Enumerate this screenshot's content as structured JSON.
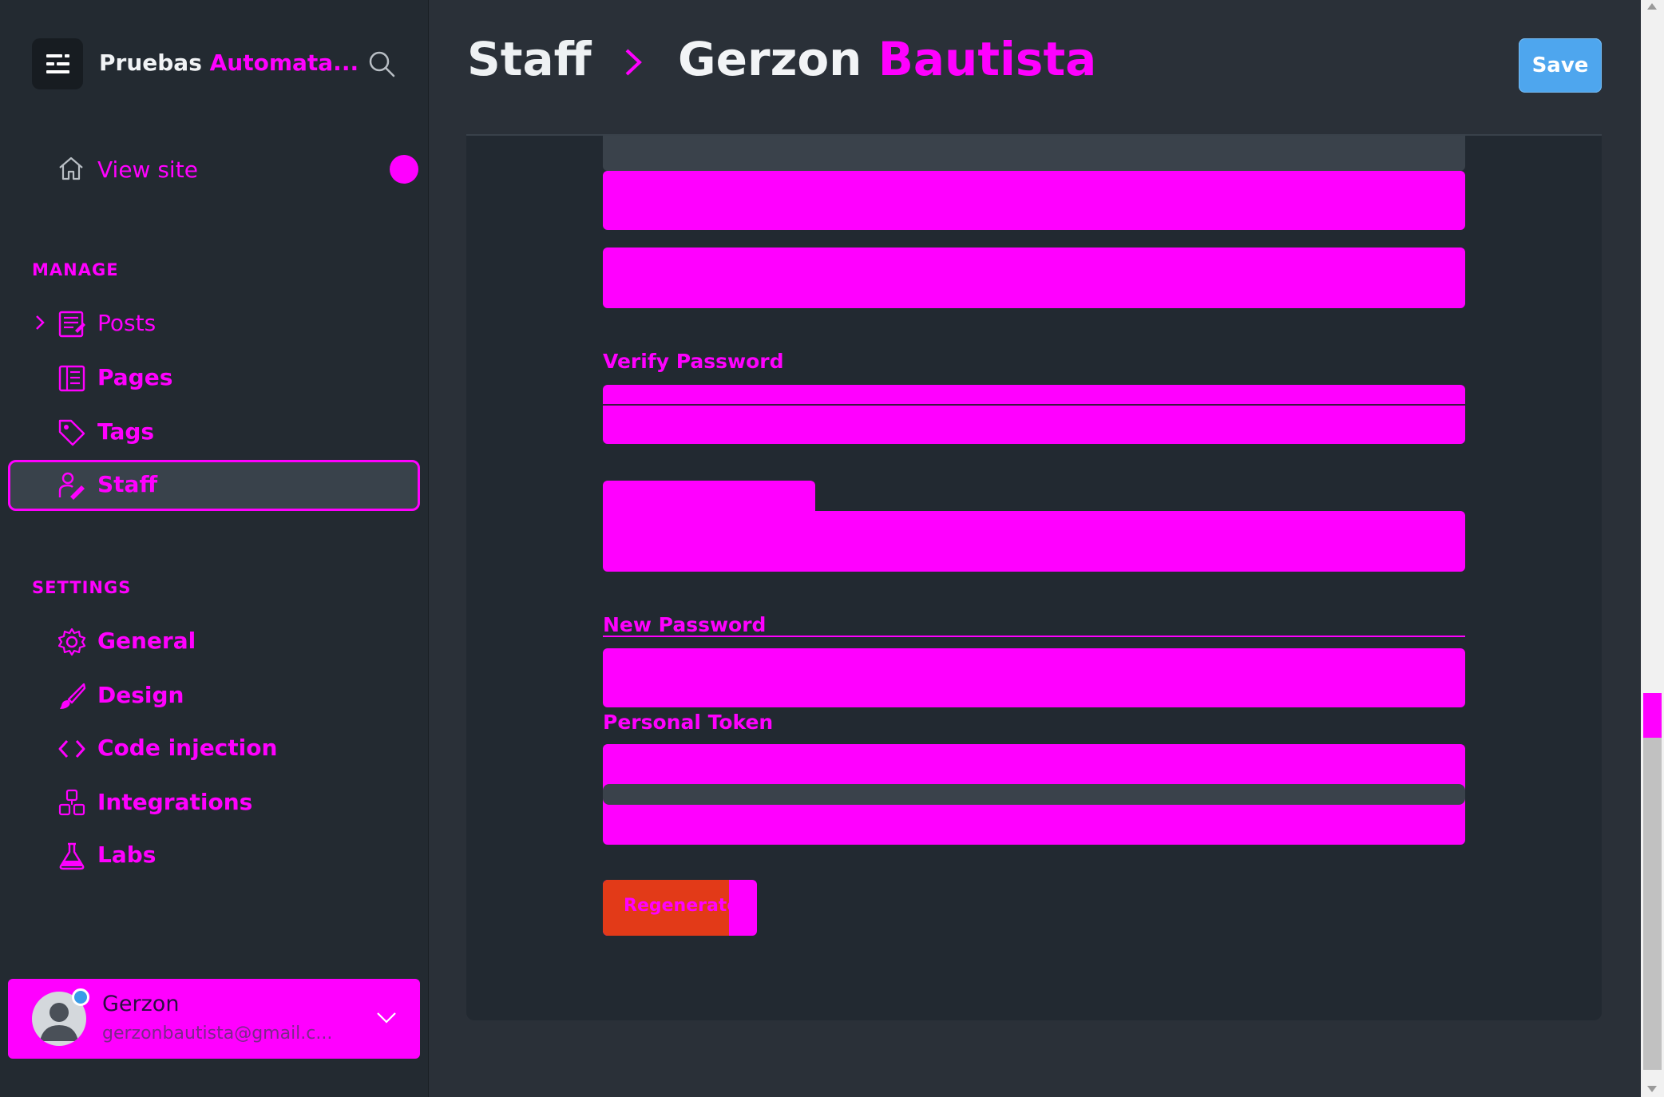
{
  "sidebar": {
    "brand_prefix": "Pruebas",
    "brand_suffix": "Automata...",
    "view_site": "View site",
    "manage_title": "MANAGE",
    "manage_items": [
      {
        "label": "Posts"
      },
      {
        "label": "Pages"
      },
      {
        "label": "Tags"
      },
      {
        "label": "Staff"
      }
    ],
    "settings_title": "SETTINGS",
    "settings_items": [
      {
        "label": "General"
      },
      {
        "label": "Design"
      },
      {
        "label": "Code injection"
      },
      {
        "label": "Integrations"
      },
      {
        "label": "Labs"
      }
    ],
    "user": {
      "name": "Gerzon",
      "email": "gerzonbautista@gmail.c..."
    }
  },
  "header": {
    "breadcrumb_root": "Staff",
    "breadcrumb_first": "Gerzon",
    "breadcrumb_last": "Bautista",
    "save_label": "Save"
  },
  "form": {
    "verify_password_label": "Verify Password",
    "new_password_label": "New Password",
    "personal_token_label": "Personal Token",
    "regenerate_label": "Regenerate"
  },
  "colors": {
    "accent": "#ff00ff",
    "save_button": "#4ea6ee",
    "danger": "#e23a18",
    "sidebar_bg": "#232a31",
    "main_bg": "#2a3038"
  }
}
